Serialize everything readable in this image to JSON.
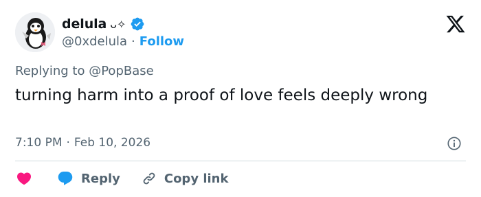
{
  "user": {
    "display_name": "delula",
    "name_decoration": "ᴗ✧",
    "handle": "@0xdelula",
    "separator": "·",
    "follow_label": "Follow"
  },
  "reply_context": {
    "prefix": "Replying to",
    "mention": "@PopBase"
  },
  "tweet": {
    "text": "turning harm into a proof of love feels deeply wrong",
    "time": "7:10 PM",
    "separator": "·",
    "date": "Feb 10, 2026"
  },
  "actions": {
    "reply_label": "Reply",
    "copy_link_label": "Copy link"
  },
  "colors": {
    "accent": "#1d9bf0",
    "like": "#f91880",
    "secondary_text": "#536471",
    "primary_text": "#0f1419",
    "divider": "#cfd9de"
  },
  "icons": {
    "verified": "verified-badge-icon",
    "brand": "x-logo-icon",
    "info": "info-icon",
    "like": "heart-icon",
    "reply": "reply-bubble-icon",
    "copy_link": "link-icon"
  }
}
